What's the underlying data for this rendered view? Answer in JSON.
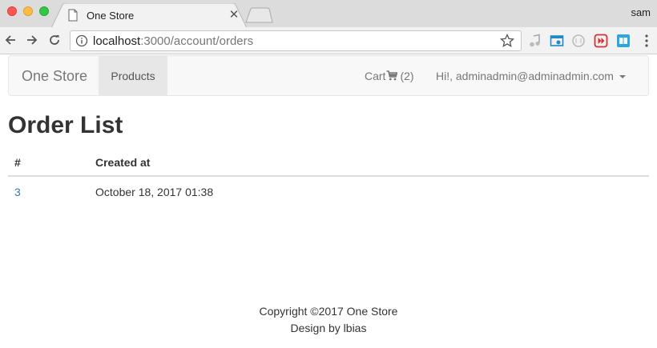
{
  "browser": {
    "tab_title": "One Store",
    "close_symbol": "✕",
    "profile_name": "sam",
    "url_host": "localhost",
    "url_path": ":3000/account/orders"
  },
  "nav": {
    "brand": "One Store",
    "products": "Products",
    "cart_label": "Cart",
    "cart_count": "(2)",
    "user_greeting": "Hi!, adminadmin@adminadmin.com"
  },
  "page": {
    "title": "Order List"
  },
  "orders_table": {
    "headers": [
      "#",
      "Created at"
    ],
    "rows": [
      {
        "id": "3",
        "created_at": "October 18, 2017 01:38"
      }
    ]
  },
  "footer": {
    "copyright": "Copyright ©2017 One Store",
    "design": "Design by lbias"
  }
}
